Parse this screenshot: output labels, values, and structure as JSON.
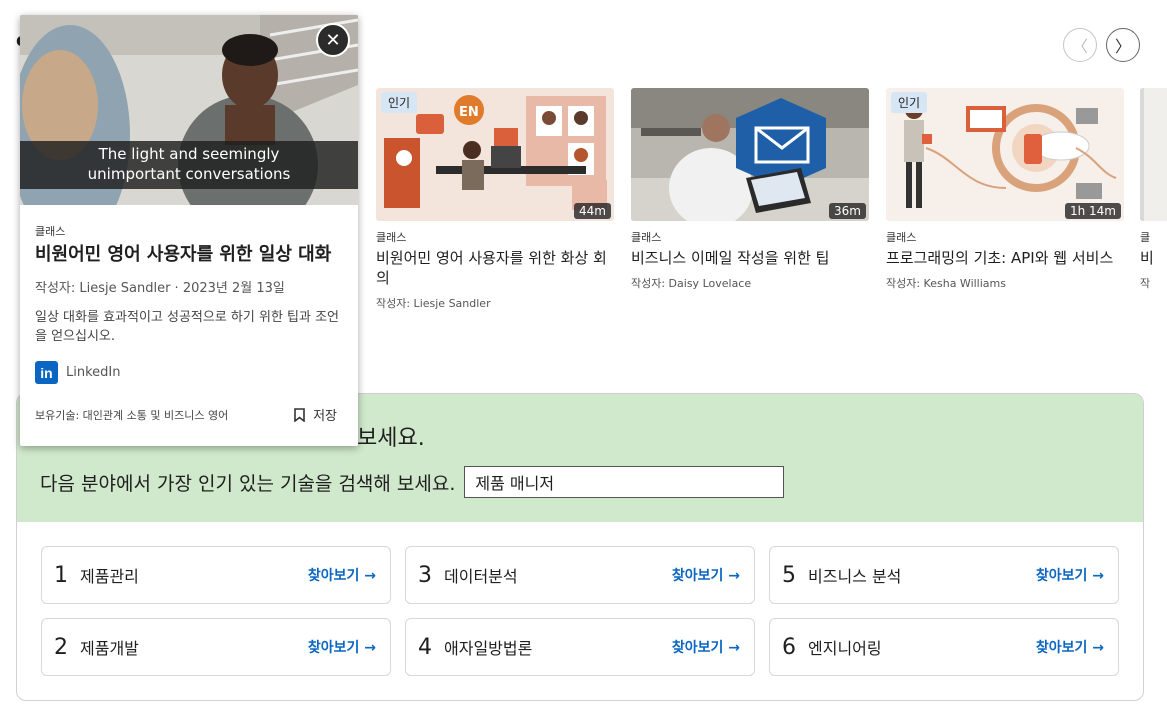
{
  "carousel": {
    "prev_icon": "chevron-left-icon",
    "next_icon": "chevron-right-icon",
    "prev_label": "〈",
    "next_label": "〉"
  },
  "cards": [
    {
      "badge": "인기",
      "duration": "44m",
      "type": "클래스",
      "title": "비원어민 영어 사용자를 위한 화상 회의",
      "author": "작성자: Liesje Sandler"
    },
    {
      "badge": "",
      "duration": "36m",
      "type": "클래스",
      "title": "비즈니스 이메일 작성을 위한 팁",
      "author": "작성자: Daisy Lovelace"
    },
    {
      "badge": "인기",
      "duration": "1h 14m",
      "type": "클래스",
      "title": "프로그래밍의 기초: API와 웹 서비스",
      "author": "작성자: Kesha Williams"
    },
    {
      "badge": "",
      "duration": "",
      "type": "클",
      "title": "비",
      "author": "작"
    }
  ],
  "popup": {
    "caption_line1": "The light and seemingly",
    "caption_line2": "unimportant conversations",
    "close_label": "✕",
    "type": "클래스",
    "title": "비원어민 영어 사용자를 위한 일상 대화",
    "meta": "작성자: Liesje Sandler  ·  2023년 2월 13일",
    "description": "일상 대화를 효과적이고 성공적으로 하기 위한 팁과 조언을 얻으십시오.",
    "provider_logo": "in",
    "provider": "LinkedIn",
    "skills": "보유기술: 대인관계 소통 및 비즈니스 영어",
    "save_label": "저장"
  },
  "skills_panel": {
    "heading_partial": "보세요.",
    "search_label": "다음 분야에서 가장 인기 있는 기술을 검색해 보세요.",
    "search_value": "제품 매니저",
    "items": [
      {
        "num": "1",
        "name": "제품관리",
        "link": "찾아보기 →"
      },
      {
        "num": "2",
        "name": "제품개발",
        "link": "찾아보기 →"
      },
      {
        "num": "3",
        "name": "데이터분석",
        "link": "찾아보기 →"
      },
      {
        "num": "4",
        "name": "애자일방법론",
        "link": "찾아보기 →"
      },
      {
        "num": "5",
        "name": "비즈니스 분석",
        "link": "찾아보기 →"
      },
      {
        "num": "6",
        "name": "엔지니어링",
        "link": "찾아보기 →"
      }
    ]
  },
  "colors": {
    "accent": "#0a66c2",
    "panel_green": "#d0e8cb",
    "badge_blue": "#d7e6f5"
  }
}
